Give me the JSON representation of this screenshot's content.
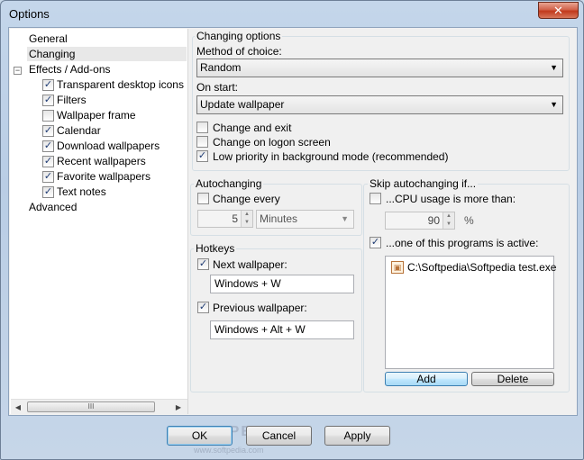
{
  "window": {
    "title": "Options",
    "close_glyph": "✕"
  },
  "tree": {
    "items": [
      {
        "label": "General"
      },
      {
        "label": "Changing"
      },
      {
        "label": "Effects / Add-ons",
        "expander": "−"
      },
      {
        "label": "Transparent desktop icons te",
        "checked": true
      },
      {
        "label": "Filters",
        "checked": true
      },
      {
        "label": "Wallpaper frame",
        "checked": false
      },
      {
        "label": "Calendar",
        "checked": true
      },
      {
        "label": "Download wallpapers",
        "checked": true
      },
      {
        "label": "Recent wallpapers",
        "checked": true
      },
      {
        "label": "Favorite wallpapers",
        "checked": true
      },
      {
        "label": "Text notes",
        "checked": true
      },
      {
        "label": "Advanced"
      }
    ],
    "scroll_grip": "III",
    "scroll_left": "◀",
    "scroll_right": "▶"
  },
  "changing_options": {
    "legend": "Changing options",
    "method_label": "Method of choice:",
    "method_value": "Random",
    "on_start_label": "On start:",
    "on_start_value": "Update wallpaper",
    "change_and_exit": "Change and exit",
    "change_on_logon": "Change on logon screen",
    "low_priority": "Low priority in background mode (recommended)",
    "low_priority_checked": true
  },
  "autochanging": {
    "legend": "Autochanging",
    "change_every_label": "Change every",
    "interval_value": "5",
    "interval_unit": "Minutes"
  },
  "hotkeys": {
    "legend": "Hotkeys",
    "next_label": "Next wallpaper:",
    "next_value": "Windows + W",
    "prev_label": "Previous wallpaper:",
    "prev_value": "Windows + Alt + W"
  },
  "skip": {
    "legend": "Skip autochanging if...",
    "cpu_label": "...CPU usage is more than:",
    "cpu_value": "90",
    "cpu_unit": "%",
    "programs_label": "...one of this programs is active:",
    "programs": [
      "C:\\Softpedia\\Softpedia test.exe"
    ],
    "add_label": "Add",
    "delete_label": "Delete"
  },
  "footer": {
    "ok_label": "OK",
    "cancel_label": "Cancel",
    "apply_label": "Apply",
    "watermark": "SOFTPEDIA",
    "watermark_url": "www.softpedia.com"
  },
  "icons": {
    "check": "✓",
    "dropdown": "▼",
    "spin_up": "▲",
    "spin_down": "▼",
    "file": "▣"
  }
}
